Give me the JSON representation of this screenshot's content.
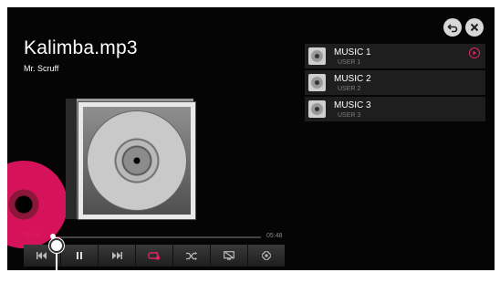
{
  "track": {
    "title": "Kalimba.mp3",
    "artist": "Mr. Scruff"
  },
  "progress": {
    "elapsed": "00:10",
    "total": "05:48",
    "fraction": 0.03
  },
  "playlist": [
    {
      "title": "MUSIC 1",
      "user": "USER 1",
      "playing": true
    },
    {
      "title": "MUSIC 2",
      "user": "USER 2",
      "playing": false
    },
    {
      "title": "MUSIC 3",
      "user": "USER 3",
      "playing": false
    }
  ],
  "controls": [
    {
      "name": "previous-button",
      "icon": "skip-previous-icon"
    },
    {
      "name": "pause-button",
      "icon": "pause-icon"
    },
    {
      "name": "next-button",
      "icon": "skip-next-icon"
    },
    {
      "name": "repeat-button",
      "icon": "repeat-icon",
      "active": true
    },
    {
      "name": "shuffle-button",
      "icon": "shuffle-icon"
    },
    {
      "name": "screen-off-button",
      "icon": "screen-off-icon"
    },
    {
      "name": "settings-button",
      "icon": "settings-icon"
    }
  ],
  "colors": {
    "accent": "#e0245e",
    "background": "#050505",
    "text": "#ffffff",
    "muted": "#7c7c7c"
  }
}
